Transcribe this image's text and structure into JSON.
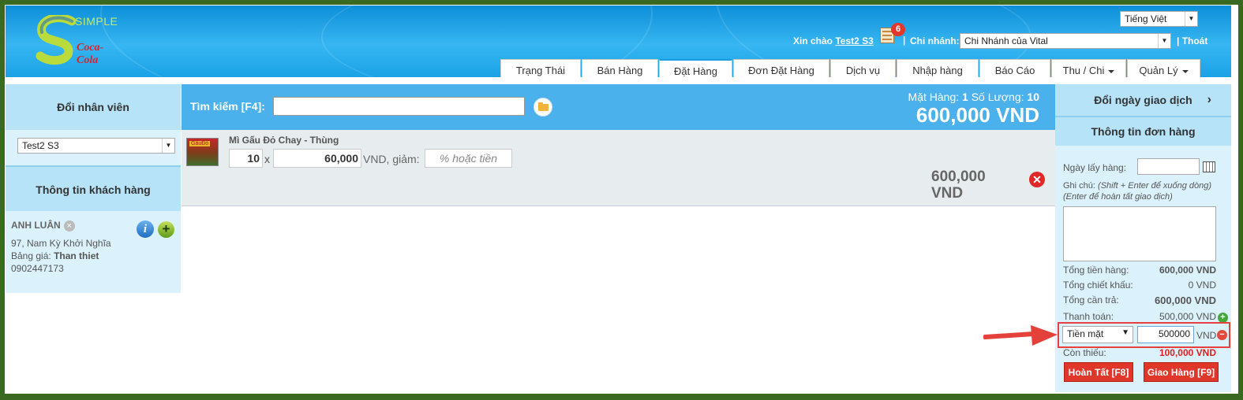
{
  "header": {
    "logo_text": "SIMPLE",
    "logo_brand": "Coca-Cola",
    "language": "Tiếng Việt",
    "greeting_prefix": "Xin chào",
    "user": "Test2 S3",
    "notifications": "6",
    "separator": "|",
    "branch_label": "Chi nhánh:",
    "branch": "Chi Nhánh của Vital",
    "logout": "| Thoát",
    "accent_color": "#1a9be0"
  },
  "nav": {
    "tabs": [
      "Trạng Thái",
      "Bán Hàng",
      "Đặt Hàng",
      "Đơn Đặt Hàng",
      "Dịch vụ",
      "Nhập hàng",
      "Báo Cáo",
      "Thu / Chi",
      "Quản Lý"
    ],
    "active": "Đặt Hàng"
  },
  "left": {
    "change_employee": "Đổi nhân viên",
    "employee": "Test2 S3",
    "customer_info": "Thông tin khách hàng",
    "customer": {
      "name": "ANH LUÂN",
      "address": "97, Nam Kỳ Khởi Nghĩa",
      "price_label": "Bảng giá:",
      "price_list": "Than thiet",
      "phone": "0902447173"
    }
  },
  "search": {
    "label": "Tìm kiếm [F4]:",
    "value": ""
  },
  "summary": {
    "items_label": "Mặt Hàng:",
    "items": "1",
    "qty_label": "Số Lượng:",
    "qty": "10",
    "total": "600,000 VND"
  },
  "item": {
    "thumb_text": "GấuĐỏ",
    "name": "Mì Gấu Đỏ Chay - Thùng",
    "quantity": "10",
    "times": "x",
    "price": "60,000",
    "vnd_discount": "VND, giảm:",
    "discount_placeholder": "% hoặc tiền",
    "line_total_1": "600,000",
    "line_total_2": "VND"
  },
  "right": {
    "change_date": "Đổi ngày giao dịch",
    "order_info": "Thông tin đơn hàng",
    "pickup_label": "Ngày lấy hàng:",
    "note_label": "Ghi chú:",
    "note_hint1": "(Shift + Enter để xuống dòng)",
    "note_hint2": "(Enter để hoàn tất giao dịch)",
    "subtotal_label": "Tổng tiền hàng:",
    "subtotal": "600,000 VND",
    "discount_label": "Tổng chiết khấu:",
    "discount": "0 VND",
    "due_label": "Tổng cần trả:",
    "due": "600,000 VND",
    "paid_label": "Thanh toán:",
    "paid": "500,000 VND",
    "pay_method": "Tiền mặt",
    "pay_amount": "500000",
    "pay_unit": "VND",
    "remaining_label": "Còn thiếu:",
    "remaining": "100,000 VND",
    "finish_button": "Hoàn Tất [F8]",
    "deliver_button": "Giao Hàng [F9]"
  }
}
